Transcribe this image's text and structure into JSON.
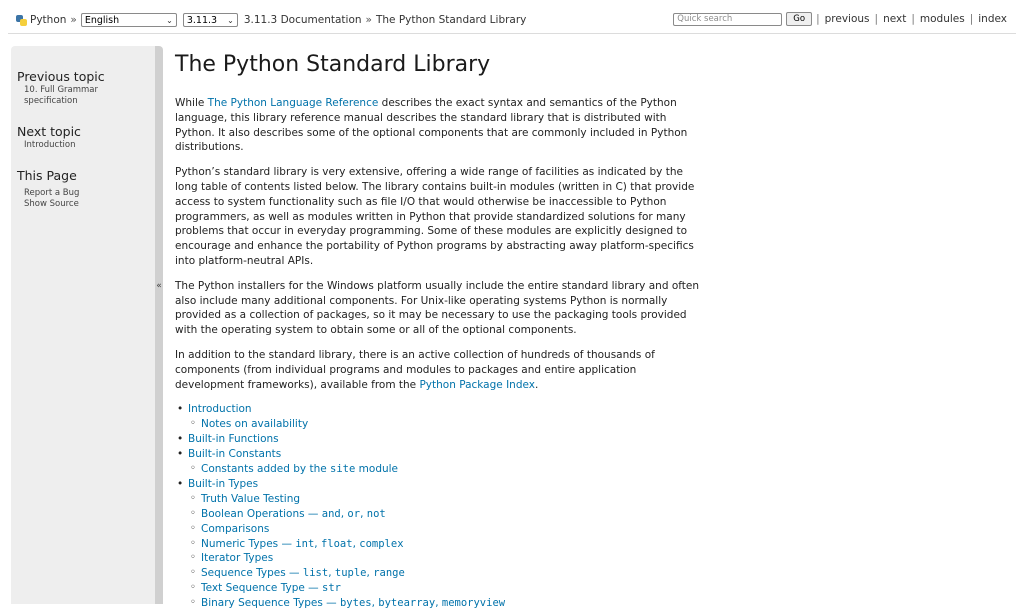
{
  "topbar": {
    "python_label": "Python",
    "sep": "»",
    "language": "English",
    "version": "3.11.3",
    "doc_title": "3.11.3 Documentation",
    "page_title": "The Python Standard Library",
    "search_placeholder": "Quick search",
    "go_label": "Go",
    "links": {
      "previous": "previous",
      "next": "next",
      "modules": "modules",
      "index": "index"
    },
    "pipe": "|"
  },
  "sidebar": {
    "previous_heading": "Previous topic",
    "previous_link_line1": "10. Full Grammar",
    "previous_link_line2": "specification",
    "next_heading": "Next topic",
    "next_link": "Introduction",
    "page_heading": "This Page",
    "report_bug": "Report a Bug",
    "show_source": "Show Source",
    "collapse_glyph": "«"
  },
  "main": {
    "title": "The Python Standard Library",
    "p1_before": "While ",
    "p1_link": "The Python Language Reference",
    "p1_after": " describes the exact syntax and semantics of the Python language, this library reference manual describes the standard library that is distributed with Python. It also describes some of the optional components that are commonly included in Python distributions.",
    "p2": "Python’s standard library is very extensive, offering a wide range of facilities as indicated by the long table of contents listed below. The library contains built-in modules (written in C) that provide access to system functionality such as file I/O that would otherwise be inaccessible to Python programmers, as well as modules written in Python that provide standardized solutions for many problems that occur in everyday programming. Some of these modules are explicitly designed to encourage and enhance the portability of Python programs by abstracting away platform-specifics into platform-neutral APIs.",
    "p3": "The Python installers for the Windows platform usually include the entire standard library and often also include many additional components. For Unix-like operating systems Python is normally provided as a collection of packages, so it may be necessary to use the packaging tools provided with the operating system to obtain some or all of the optional components.",
    "p4_before": "In addition to the standard library, there is an active collection of hundreds of thousands of components (from individual programs and modules to packages and entire application development frameworks), available from the ",
    "p4_link": "Python Package Index",
    "p4_after": "."
  },
  "toc": {
    "introduction": "Introduction",
    "notes_availability": "Notes on availability",
    "builtin_functions": "Built-in Functions",
    "builtin_constants": "Built-in Constants",
    "constants_site_before": "Constants added by the ",
    "constants_site_code": "site",
    "constants_site_after": " module",
    "builtin_types": "Built-in Types",
    "truth_value": "Truth Value Testing",
    "boolean_ops": "Boolean Operations — ",
    "boolean_and": "and",
    "boolean_or": "or",
    "boolean_not": "not",
    "comparisons": "Comparisons",
    "numeric_types": "Numeric Types — ",
    "numeric_int": "int",
    "numeric_float": "float",
    "numeric_complex": "complex",
    "iterator_types": "Iterator Types",
    "sequence_types": "Sequence Types — ",
    "seq_list": "list",
    "seq_tuple": "tuple",
    "seq_range": "range",
    "text_seq": "Text Sequence Type — ",
    "text_str": "str",
    "binary_seq": "Binary Sequence Types — ",
    "bin_bytes": "bytes",
    "bin_bytearray": "bytearray",
    "bin_memoryview": "memoryview",
    "comma": ", "
  }
}
